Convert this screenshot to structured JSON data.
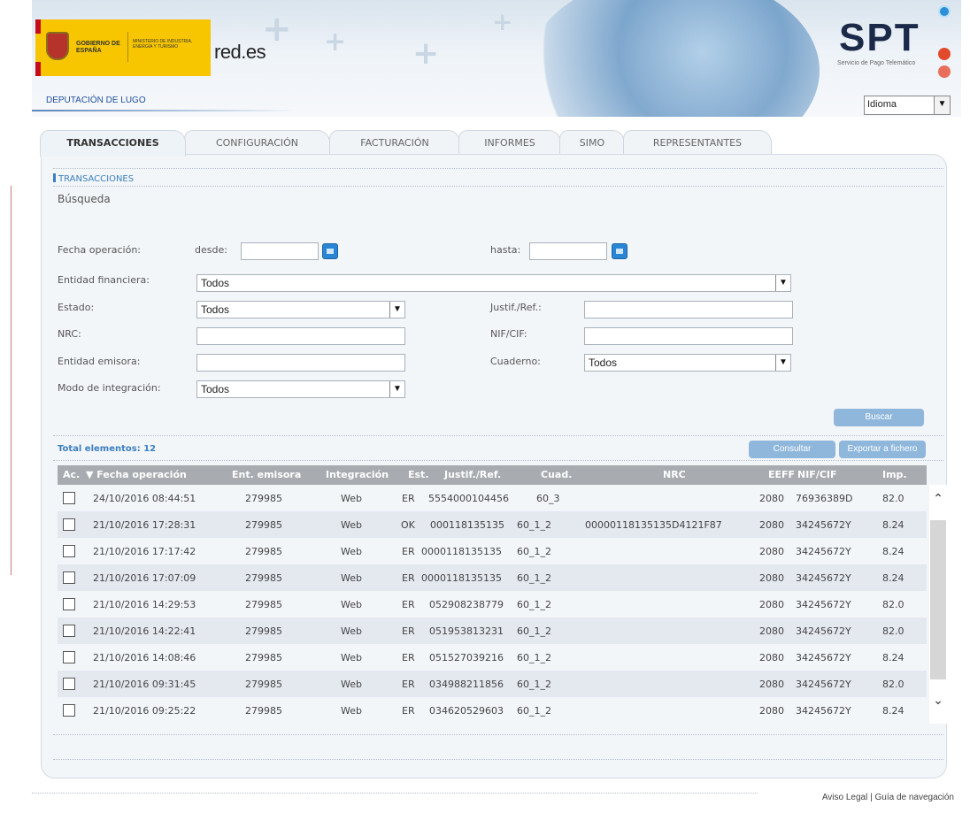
{
  "header": {
    "gov_logo": "GOBIERNO DE ESPAÑA",
    "ministry": "MINISTERIO DE INDUSTRIA, ENERGÍA Y TURISMO",
    "redes": "red.es",
    "spt_logo": "SPT",
    "spt_subtitle": "Servicio de Pago Telemático",
    "department": "DEPUTACIÓN DE LUGO",
    "language_select": "Idioma"
  },
  "tabs": [
    {
      "label": "TRANSACCIONES",
      "active": true
    },
    {
      "label": "CONFIGURACIÓN",
      "active": false
    },
    {
      "label": "FACTURACIÓN",
      "active": false
    },
    {
      "label": "INFORMES",
      "active": false
    },
    {
      "label": "SIMO",
      "active": false
    },
    {
      "label": "REPRESENTANTES",
      "active": false
    }
  ],
  "section": {
    "title": "TRANSACCIONES",
    "subtitle": "Búsqueda"
  },
  "form": {
    "fecha_operacion": "Fecha operación:",
    "desde": "desde:",
    "desde_value": "",
    "hasta": "hasta:",
    "hasta_value": "",
    "entidad_financiera": "Entidad financiera:",
    "entidad_financiera_value": "Todos",
    "estado": "Estado:",
    "estado_value": "Todos",
    "justif_ref": "Justif./Ref.:",
    "justif_ref_value": "",
    "nrc": "NRC:",
    "nrc_value": "",
    "nif_cif": "NIF/CIF:",
    "nif_cif_value": "",
    "entidad_emisora": "Entidad emisora:",
    "entidad_emisora_value": "",
    "cuaderno": "Cuaderno:",
    "cuaderno_value": "Todos",
    "modo_integracion": "Modo de integración:",
    "modo_integracion_value": "Todos"
  },
  "actions": {
    "buscar": "Buscar",
    "consultar": "Consultar",
    "exportar": "Exportar a fichero"
  },
  "total": "Total elementos: 12",
  "table": {
    "headers": {
      "ac": "Ac.",
      "fecha": "▼ Fecha operación",
      "ent_emisora": "Ent. emisora",
      "integracion": "Integración",
      "est": "Est.",
      "justif": "Justif./Ref.",
      "cuad": "Cuad.",
      "nrc": "NRC",
      "eeff": "EEFF",
      "nif": "NIF/CIF",
      "imp": "Imp."
    },
    "rows": [
      {
        "fecha": "24/10/2016 08:44:51",
        "ent": "279985",
        "integ": "Web",
        "est": "ER",
        "justif": "5554000104456",
        "cuad": "60_3",
        "nrc": "",
        "eeff": "2080",
        "nif": "76936389D",
        "imp": "82.0"
      },
      {
        "fecha": "21/10/2016 17:28:31",
        "ent": "279985",
        "integ": "Web",
        "est": "OK",
        "justif": "000118135135",
        "cuad": "60_1_2",
        "nrc": "00000118135135D4121F87",
        "eeff": "2080",
        "nif": "34245672Y",
        "imp": "8.24"
      },
      {
        "fecha": "21/10/2016 17:17:42",
        "ent": "279985",
        "integ": "Web",
        "est": "ER",
        "justif": "0000118135135",
        "cuad": "60_1_2",
        "nrc": "",
        "eeff": "2080",
        "nif": "34245672Y",
        "imp": "8.24"
      },
      {
        "fecha": "21/10/2016 17:07:09",
        "ent": "279985",
        "integ": "Web",
        "est": "ER",
        "justif": "0000118135135",
        "cuad": "60_1_2",
        "nrc": "",
        "eeff": "2080",
        "nif": "34245672Y",
        "imp": "8.24"
      },
      {
        "fecha": "21/10/2016 14:29:53",
        "ent": "279985",
        "integ": "Web",
        "est": "ER",
        "justif": "052908238779",
        "cuad": "60_1_2",
        "nrc": "",
        "eeff": "2080",
        "nif": "34245672Y",
        "imp": "82.0"
      },
      {
        "fecha": "21/10/2016 14:22:41",
        "ent": "279985",
        "integ": "Web",
        "est": "ER",
        "justif": "051953813231",
        "cuad": "60_1_2",
        "nrc": "",
        "eeff": "2080",
        "nif": "34245672Y",
        "imp": "82.0"
      },
      {
        "fecha": "21/10/2016 14:08:46",
        "ent": "279985",
        "integ": "Web",
        "est": "ER",
        "justif": "051527039216",
        "cuad": "60_1_2",
        "nrc": "",
        "eeff": "2080",
        "nif": "34245672Y",
        "imp": "8.24"
      },
      {
        "fecha": "21/10/2016 09:31:45",
        "ent": "279985",
        "integ": "Web",
        "est": "ER",
        "justif": "034988211856",
        "cuad": "60_1_2",
        "nrc": "",
        "eeff": "2080",
        "nif": "34245672Y",
        "imp": "82.0"
      },
      {
        "fecha": "21/10/2016 09:25:22",
        "ent": "279985",
        "integ": "Web",
        "est": "ER",
        "justif": "034620529603",
        "cuad": "60_1_2",
        "nrc": "",
        "eeff": "2080",
        "nif": "34245672Y",
        "imp": "8.24"
      }
    ]
  },
  "footer": "Aviso Legal | Guía de navegación",
  "colors": {
    "accent": "#3b7fc0",
    "button": "#8fb7dc",
    "grid_header": "#a8acb0",
    "row_alt": "#e4e9f0"
  },
  "icons": {
    "power": "power-icon",
    "help": "help-icon",
    "exit": "exit-icon",
    "calendar": "calendar-icon"
  }
}
